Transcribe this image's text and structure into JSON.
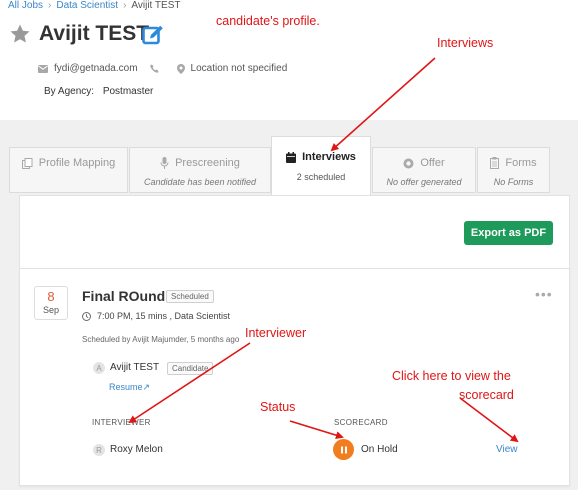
{
  "breadcrumb": {
    "items": [
      "All Jobs",
      "Data Scientist",
      "Avijit TEST"
    ]
  },
  "candidate": {
    "name": "Avijit TEST",
    "email": "fydi@getnada.com",
    "location": "Location not specified",
    "agency_label": "By Agency:",
    "agency_value": "Postmaster"
  },
  "tabs": [
    {
      "label": "Profile Mapping",
      "sub": "",
      "icon": "copy-icon",
      "active": false
    },
    {
      "label": "Prescreening",
      "sub": "Candidate has been notified",
      "icon": "microphone-icon",
      "active": false
    },
    {
      "label": "Interviews",
      "sub": "2 scheduled",
      "icon": "calendar-icon",
      "active": true
    },
    {
      "label": "Offer",
      "sub": "No offer generated",
      "icon": "circle-icon",
      "active": false
    },
    {
      "label": "Forms",
      "sub": "No Forms",
      "icon": "clipboard-icon",
      "active": false
    }
  ],
  "toolbar": {
    "export_label": "Export as PDF"
  },
  "interview": {
    "date_day": "8",
    "date_month": "Sep",
    "title": "Final ROund",
    "badge": "Scheduled",
    "time": "7:00 PM, 15 mins , Data Scientist",
    "scheduled_by": "Scheduled by Avijit Majumder, 5 months ago",
    "candidate_name": "Avijit TEST",
    "candidate_badge": "Candidate",
    "candidate_initial": "A",
    "resume_label": "Resume↗",
    "interviewer_header": "INTERVIEWER",
    "scorecard_header": "SCORECARD",
    "interviewer_name": "Roxy Melon",
    "interviewer_initial": "R",
    "status": "On Hold",
    "view_label": "View"
  },
  "annotations": {
    "profile": "candidate's profile.",
    "interviews": "Interviews",
    "interviewer": "Interviewer",
    "status": "Status",
    "scorecard_line1": "Click here to view the",
    "scorecard_line2": "scorecard"
  },
  "colors": {
    "accent": "#3a86c8",
    "export_button": "#1e9a5a",
    "status_on_hold": "#f07d1e",
    "annotation": "#e01515",
    "date_day": "#e05a3a"
  }
}
